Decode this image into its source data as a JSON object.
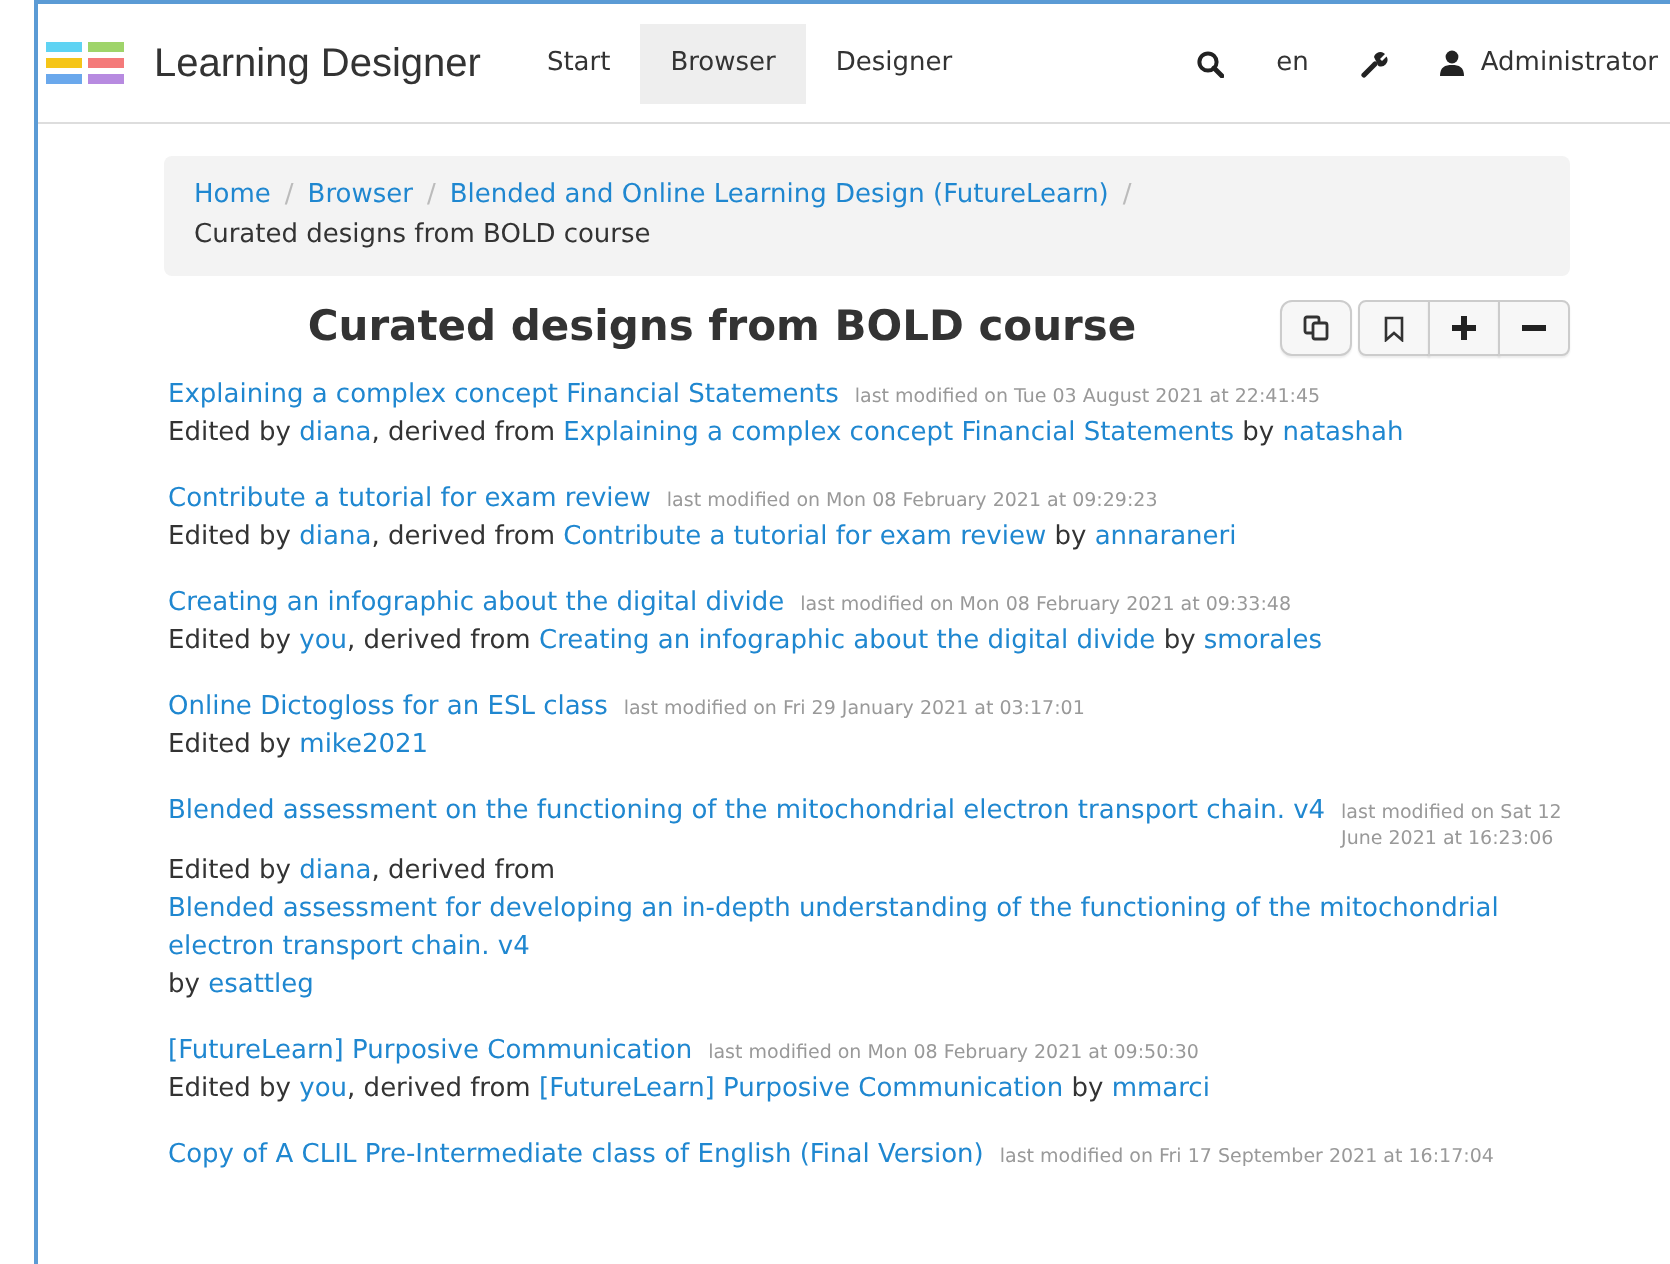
{
  "navbar": {
    "brand": "Learning Designer",
    "items": [
      {
        "label": "Start",
        "selected": false
      },
      {
        "label": "Browser",
        "selected": true
      },
      {
        "label": "Designer",
        "selected": false
      }
    ],
    "language": "en",
    "user": "Administrator"
  },
  "breadcrumb": [
    {
      "label": "Home",
      "kind": "link"
    },
    {
      "separator": "/",
      "label": "Browser",
      "kind": "link"
    },
    {
      "separator": "/",
      "label": "Blended and Online Learning Design (FutureLearn)",
      "kind": "link"
    },
    {
      "separator": "/",
      "label": "Curated designs from BOLD course",
      "kind": "current"
    }
  ],
  "page_title": "Curated designs from BOLD course",
  "designs": [
    {
      "title": "Explaining a complex concept Financial Statements",
      "modified": "last modified on Tue 03 August 2021 at 22:41:45",
      "credit": [
        {
          "text": "Edited by",
          "kind": "plain"
        },
        {
          "text": "diana",
          "kind": "user"
        },
        {
          "text": ", derived from",
          "kind": "plain"
        },
        {
          "text": "Explaining a complex concept Financial Statements",
          "kind": "design"
        },
        {
          "text": "by",
          "kind": "plain"
        },
        {
          "text": "natashah",
          "kind": "user"
        }
      ]
    },
    {
      "title": "Contribute a tutorial for exam review",
      "modified": "last modified on Mon 08 February 2021 at 09:29:23",
      "credit": [
        {
          "text": "Edited by",
          "kind": "plain"
        },
        {
          "text": "diana",
          "kind": "user"
        },
        {
          "text": ", derived from",
          "kind": "plain"
        },
        {
          "text": "Contribute a tutorial for exam review",
          "kind": "design"
        },
        {
          "text": "by",
          "kind": "plain"
        },
        {
          "text": "annaraneri",
          "kind": "user"
        }
      ]
    },
    {
      "title": "Creating an infographic about the digital divide",
      "modified": "last modified on Mon 08 February 2021 at 09:33:48",
      "credit": [
        {
          "text": "Edited by",
          "kind": "plain"
        },
        {
          "text": "you",
          "kind": "user"
        },
        {
          "text": ", derived from",
          "kind": "plain"
        },
        {
          "text": "Creating an infographic about the digital divide",
          "kind": "design"
        },
        {
          "text": "by",
          "kind": "plain"
        },
        {
          "text": "smorales",
          "kind": "user"
        }
      ]
    },
    {
      "title": "Online Dictogloss for an ESL class",
      "modified": "last modified on Fri 29 January 2021 at 03:17:01",
      "credit": [
        {
          "text": "Edited by",
          "kind": "plain"
        },
        {
          "text": "mike2021",
          "kind": "user"
        }
      ]
    },
    {
      "title": "Blended assessment on the functioning of the mitochondrial electron transport chain. v4",
      "modified": "last modified on Sat 12 June 2021 at 16:23:06",
      "credit": [
        {
          "text": "Edited by",
          "kind": "plain"
        },
        {
          "text": "diana",
          "kind": "user"
        },
        {
          "text": ", derived from",
          "kind": "plain"
        },
        {
          "text": "Blended assessment for developing an in-depth understanding of the functioning of the mitochondrial electron transport chain. v4",
          "kind": "design"
        },
        {
          "text": "by",
          "kind": "plain"
        },
        {
          "text": "esattleg",
          "kind": "user"
        }
      ]
    },
    {
      "title": "[FutureLearn] Purposive Communication",
      "modified": "last modified on Mon 08 February 2021 at 09:50:30",
      "credit": [
        {
          "text": "Edited by",
          "kind": "plain"
        },
        {
          "text": "you",
          "kind": "user"
        },
        {
          "text": ", derived from",
          "kind": "plain"
        },
        {
          "text": "[FutureLearn] Purposive Communication",
          "kind": "design"
        },
        {
          "text": "by",
          "kind": "plain"
        },
        {
          "text": "mmarci",
          "kind": "user"
        }
      ]
    },
    {
      "title": "Copy of A CLIL Pre-Intermediate class of English (Final Version)",
      "modified": "last modified on Fri 17 September 2021 at 16:17:04"
    }
  ]
}
